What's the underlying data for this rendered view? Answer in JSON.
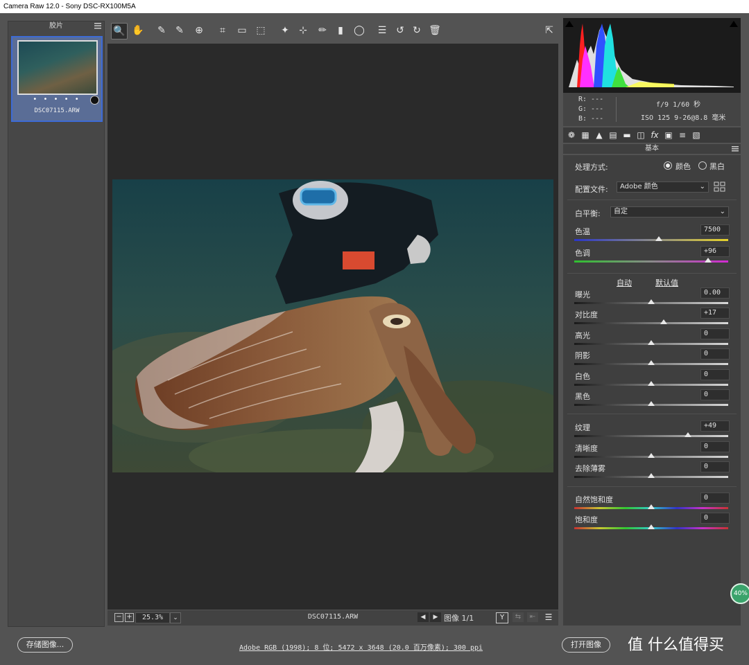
{
  "window": {
    "title": "Camera Raw 12.0 -  Sony DSC-RX100M5A"
  },
  "filmstrip": {
    "title": "胶片",
    "thumbnail": {
      "filename": "DSC07115.ARW",
      "rating_dots": "• • • • •"
    }
  },
  "toolbar": {
    "tools": [
      {
        "name": "zoom-tool-icon",
        "glyph": "🔍"
      },
      {
        "name": "hand-tool-icon",
        "glyph": "✋"
      },
      {
        "name": "white-balance-tool-icon",
        "glyph": "✎"
      },
      {
        "name": "color-sampler-tool-icon",
        "glyph": "✎"
      },
      {
        "name": "targeted-adjustment-tool-icon",
        "glyph": "⊕"
      },
      {
        "name": "crop-tool-icon",
        "glyph": "⌗"
      },
      {
        "name": "straighten-tool-icon",
        "glyph": "▭"
      },
      {
        "name": "transform-tool-icon",
        "glyph": "⬚"
      },
      {
        "name": "spot-removal-tool-icon",
        "glyph": "✦"
      },
      {
        "name": "red-eye-tool-icon",
        "glyph": "⊹"
      },
      {
        "name": "adjustment-brush-icon",
        "glyph": "✏"
      },
      {
        "name": "graduated-filter-icon",
        "glyph": "▮"
      },
      {
        "name": "radial-filter-icon",
        "glyph": "◯"
      },
      {
        "name": "preferences-icon",
        "glyph": "☰"
      },
      {
        "name": "rotate-left-icon",
        "glyph": "↺"
      },
      {
        "name": "rotate-right-icon",
        "glyph": "↻"
      },
      {
        "name": "delete-icon",
        "glyph": "🗑"
      }
    ],
    "fullscreen_icon": "⇱"
  },
  "preview": {
    "zoom": "25.3%",
    "filename": "DSC07115.ARW",
    "image_count": "图像 1/1"
  },
  "histogram": {
    "readout": {
      "r": "R:    ---",
      "g": "G:    ---",
      "b": "B:    ---",
      "exposure": "f/9   1/60 秒",
      "iso": "ISO 125   9-26@8.8 毫米"
    }
  },
  "panel": {
    "title": "基本",
    "process_label": "处理方式:",
    "color_option": "颜色",
    "bw_option": "黑白",
    "profile_label": "配置文件:",
    "profile_value": "Adobe 颜色",
    "wb_label": "白平衡:",
    "wb_value": "自定",
    "auto_link": "自动",
    "default_link": "默认值",
    "sliders": [
      {
        "label": "色温",
        "value": "7500",
        "pos": 0.55,
        "track": "temp"
      },
      {
        "label": "色调",
        "value": "+96",
        "pos": 0.87,
        "track": "tint"
      },
      {
        "label": "曝光",
        "value": "0.00",
        "pos": 0.5,
        "track": "gray"
      },
      {
        "label": "对比度",
        "value": "+17",
        "pos": 0.58,
        "track": "gray"
      },
      {
        "label": "高光",
        "value": "0",
        "pos": 0.5,
        "track": "gray"
      },
      {
        "label": "阴影",
        "value": "0",
        "pos": 0.5,
        "track": "gray"
      },
      {
        "label": "白色",
        "value": "0",
        "pos": 0.5,
        "track": "gray"
      },
      {
        "label": "黑色",
        "value": "0",
        "pos": 0.5,
        "track": "gray"
      },
      {
        "label": "纹理",
        "value": "+49",
        "pos": 0.74,
        "track": "gray"
      },
      {
        "label": "清晰度",
        "value": "0",
        "pos": 0.5,
        "track": "gray"
      },
      {
        "label": "去除薄雾",
        "value": "0",
        "pos": 0.5,
        "track": "gray"
      },
      {
        "label": "自然饱和度",
        "value": "0",
        "pos": 0.5,
        "track": "rainbow"
      },
      {
        "label": "饱和度",
        "value": "0",
        "pos": 0.5,
        "track": "rainbow"
      }
    ]
  },
  "bottom": {
    "save_label": "存储图像...",
    "workflow": "Adobe RGB (1998); 8 位;  5472 x 3648 (20.0 百万像素); 300 ppi",
    "open_label": "打开图像",
    "watermark": "值 什么值得买"
  },
  "badge": "40%",
  "colors": {
    "accent": "#3d6bd6",
    "badge": "#3aa36b"
  }
}
